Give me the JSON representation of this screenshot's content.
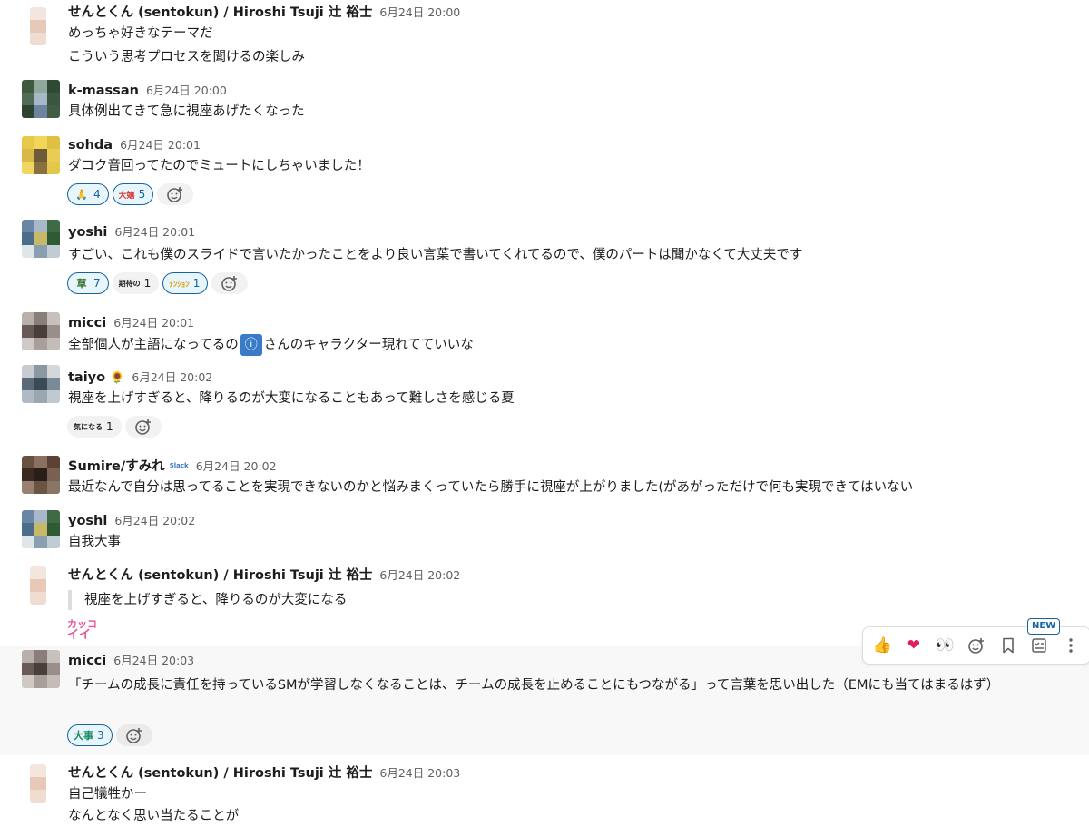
{
  "messages": [
    {
      "name": "せんとくん (sentokun) / Hiroshi Tsuji 辻 裕士",
      "time": "6月24日 20:00",
      "lines": [
        "めっちゃ好きなテーマだ",
        "こういう思考プロセスを聞けるの楽しみ"
      ]
    },
    {
      "name": "k-massan",
      "time": "6月24日 20:00",
      "lines": [
        "具体例出てきて急に視座あげたくなった"
      ]
    },
    {
      "name": "sohda",
      "time": "6月24日 20:01",
      "lines": [
        "ダコク音回ってたのでミュートにしちゃいました！"
      ],
      "reactions": [
        {
          "emoji": "🙏",
          "count": "4",
          "active": true
        },
        {
          "emoji": "大嬉",
          "count": "5",
          "active": true
        }
      ]
    },
    {
      "name": "yoshi",
      "time": "6月24日 20:01",
      "lines": [
        "すごい、これも僕のスライドで言いたかったことをより良い言葉で書いてくれてるので、僕のパートは聞かなくて大丈夫です"
      ],
      "reactions": [
        {
          "emoji": "草",
          "count": "7",
          "active": true
        },
        {
          "emoji": "期待の",
          "count": "1",
          "active": false
        },
        {
          "emoji": "ﾃﾝｼｮﾝ",
          "count": "1",
          "active": true
        }
      ]
    },
    {
      "name": "micci",
      "time": "6月24日 20:01",
      "line_before": "全部個人が主語になってるの",
      "line_after": "さんのキャラクター現れてていいな",
      "inline_emoji": "ⓘ"
    },
    {
      "name": "taiyo",
      "status_emoji": "🌻",
      "time": "6月24日 20:02",
      "lines": [
        "視座を上げすぎると、降りるのが大変になることもあって難しさを感じる夏"
      ],
      "reactions": [
        {
          "emoji": "気になる",
          "count": "1",
          "active": false
        }
      ]
    },
    {
      "name": "Sumire/すみれ",
      "status_emoji": "Slack",
      "time": "6月24日 20:02",
      "lines": [
        "最近なんで自分は思ってることを実現できないのかと悩みまくっていたら勝手に視座が上がりました(があがっただけで何も実現できてはいない"
      ]
    },
    {
      "name": "yoshi",
      "time": "6月24日 20:02",
      "lines": [
        "自我大事"
      ]
    },
    {
      "name": "せんとくん (sentokun) / Hiroshi Tsuji 辻 裕士",
      "time": "6月24日 20:02",
      "quote": "視座を上げすぎると、降りるのが大変になる",
      "sticker": [
        "カッコ",
        "イイ"
      ]
    },
    {
      "name": "micci",
      "time": "6月24日 20:03",
      "text": "「チームの成長に責任を持っているSMが学習しなくなることは、チームの成長を止めることにもつながる」って言葉を思い出した（EMにも当てはまるはず）",
      "reactions": [
        {
          "emoji": "大事",
          "count": "3",
          "active": true
        }
      ]
    },
    {
      "name": "せんとくん (sentokun) / Hiroshi Tsuji 辻 裕士",
      "time": "6月24日 20:03",
      "lines": [
        "自己犠牲かー",
        "なんとなく思い当たることが"
      ]
    }
  ],
  "toolbar": {
    "items": [
      {
        "icon": "thumbs-up-icon",
        "glyph": "👍"
      },
      {
        "icon": "heart-icon",
        "glyph": "❤"
      },
      {
        "icon": "eyes-icon",
        "glyph": "👀"
      }
    ],
    "new_badge": "NEW"
  },
  "colors": {
    "link_blue": "#1264a3",
    "reaction_bg": "#e8f5fa",
    "highlight_bg": "#f8f8f8",
    "text": "#1d1c1d",
    "muted": "#616061"
  }
}
